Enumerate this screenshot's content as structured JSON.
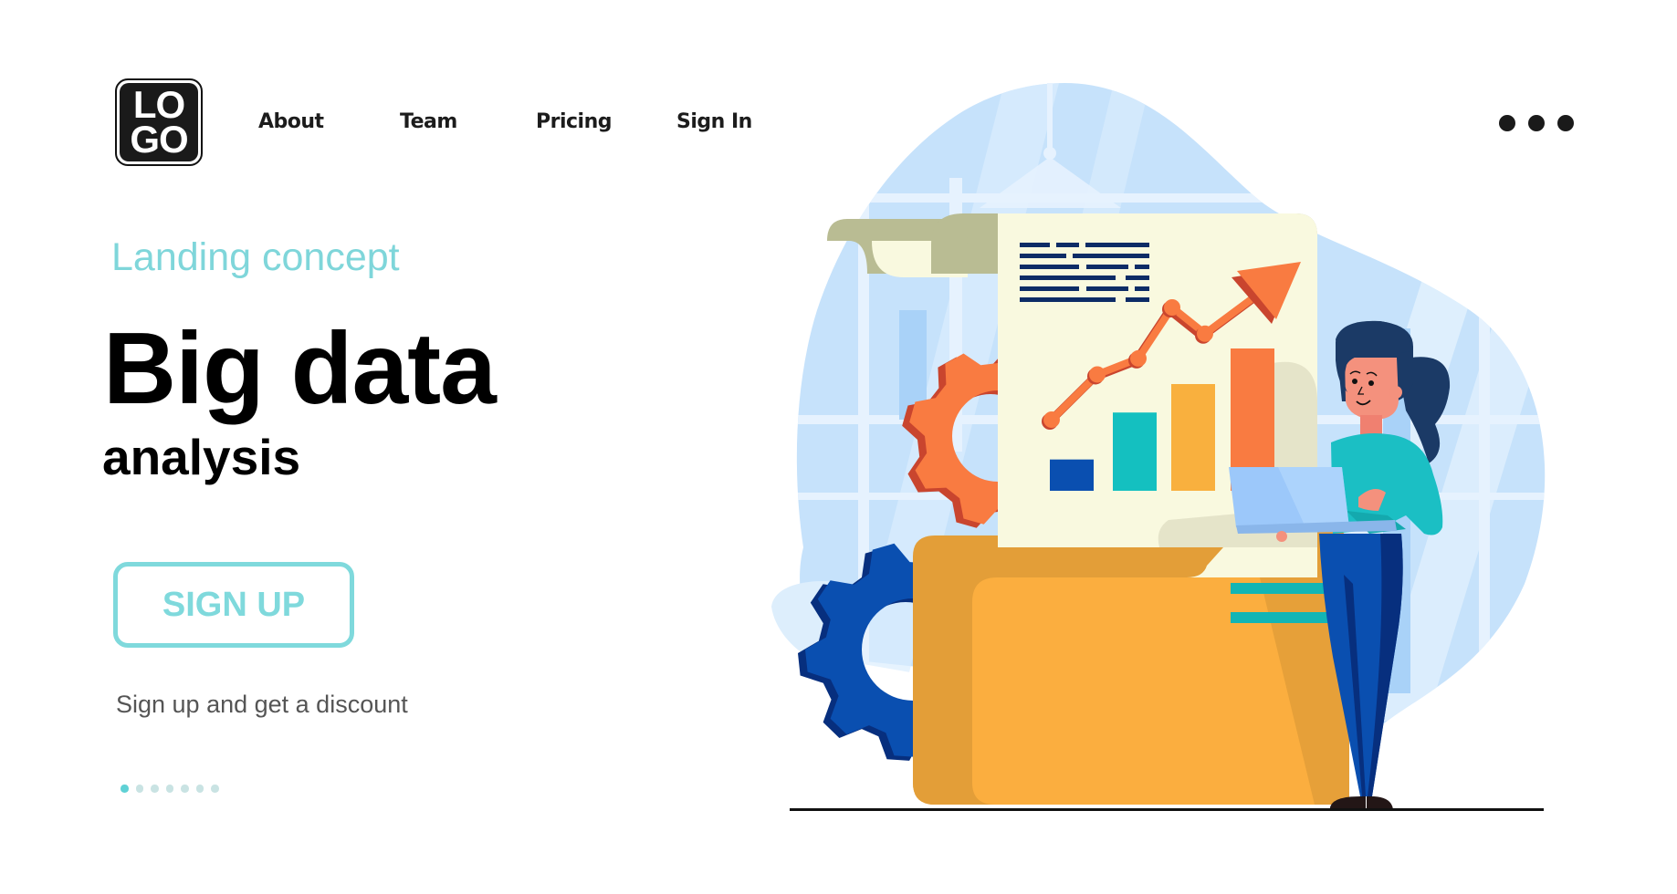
{
  "logo": {
    "line1": "LO",
    "line2": "GO"
  },
  "nav": {
    "items": [
      {
        "label": "About"
      },
      {
        "label": "Team"
      },
      {
        "label": "Pricing"
      },
      {
        "label": "Sign In"
      }
    ],
    "more_icon": "more-horizontal-icon"
  },
  "hero": {
    "eyebrow": "Landing concept",
    "title": "Big data",
    "subtitle": "analysis",
    "cta_label": "SIGN UP",
    "caption": "Sign up and get a discount"
  },
  "pager": {
    "total": 7,
    "active_index": 0
  },
  "illustration": {
    "subject": "Woman holding a laptop next to a big folder with a chart document and gears",
    "document_chart": {
      "bars_relative": [
        0.22,
        0.55,
        0.75,
        1.0
      ],
      "bar_colors": [
        "#0A4FB0",
        "#14C0C0",
        "#F9B03E",
        "#F97B41"
      ],
      "trend_points_relative": [
        0.0,
        0.31,
        0.42,
        0.77,
        0.59
      ],
      "text_lines": 6
    },
    "colors": {
      "blob": "#C6E2FB",
      "paper": "#F9F9DF",
      "scroll": "#B9BC93",
      "folder_back": "#E39E38",
      "folder_front": "#FBAE3F",
      "gear_orange": "#F97B41",
      "gear_blue": "#0A4FB0",
      "navy": "#0D2C66",
      "sweater": "#1BBFC4",
      "pants": "#0A4FB0",
      "skin": "#F4917D",
      "hair": "#1B3A66",
      "laptop": "#9CC8FA"
    }
  }
}
